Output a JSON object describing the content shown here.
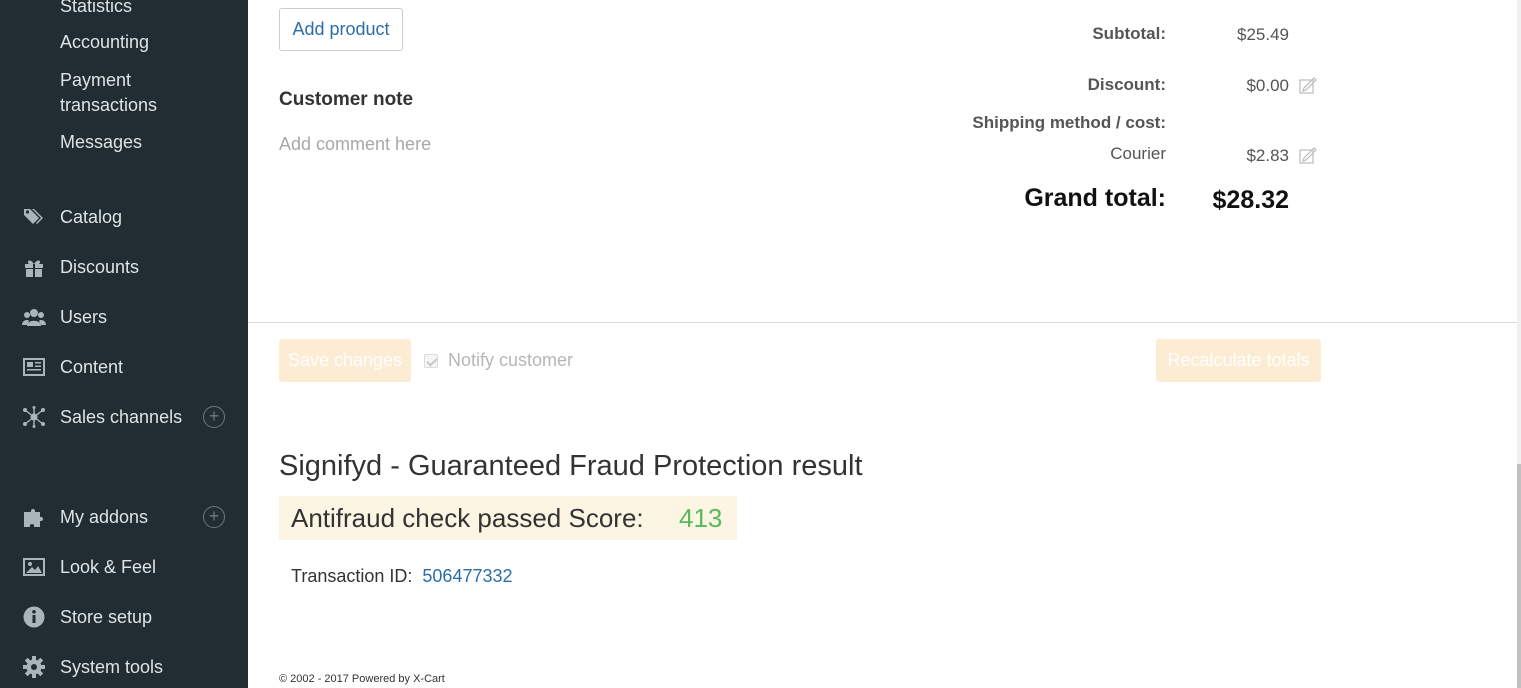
{
  "sidebar": {
    "sub_items": [
      "Statistics",
      "Accounting",
      "Payment\ntransactions",
      "Messages"
    ],
    "items": [
      {
        "label": "Catalog",
        "icon": "tags-icon"
      },
      {
        "label": "Discounts",
        "icon": "gift-icon"
      },
      {
        "label": "Users",
        "icon": "users-icon"
      },
      {
        "label": "Content",
        "icon": "newspaper-icon"
      },
      {
        "label": "Sales channels",
        "icon": "network-icon",
        "expandable": true
      },
      {
        "label": "My addons",
        "icon": "puzzle-icon",
        "expandable": true
      },
      {
        "label": "Look & Feel",
        "icon": "image-icon"
      },
      {
        "label": "Store setup",
        "icon": "info-icon"
      },
      {
        "label": "System tools",
        "icon": "gear-icon"
      }
    ],
    "plus_symbol": "+"
  },
  "order": {
    "add_product_label": "Add product",
    "customer_note_title": "Customer note",
    "customer_note_placeholder": "Add comment here",
    "totals": {
      "subtotal_label": "Subtotal:",
      "subtotal_value": "$25.49",
      "discount_label": "Discount:",
      "discount_value": "$0.00",
      "shipping_label": "Shipping method / cost:",
      "shipping_method": "Courier",
      "shipping_value": "$2.83",
      "grand_total_label": "Grand total:",
      "grand_total_value": "$28.32"
    }
  },
  "actions": {
    "save_label": "Save changes",
    "notify_label": "Notify customer",
    "notify_checked": true,
    "recalc_label": "Recalculate totals"
  },
  "signifyd": {
    "title": "Signifyd - Guaranteed Fraud Protection result",
    "result_label": "Antifraud check passed Score:",
    "score": "413",
    "transaction_label": "Transaction ID:",
    "transaction_id": "506477332"
  },
  "footer": {
    "text": "© 2002 - 2017 Powered by X-Cart"
  },
  "colors": {
    "sidebar_bg": "#222d32",
    "link": "#2b6ea8",
    "score": "#5cb85c",
    "disabled_button": "#fdecd4"
  }
}
